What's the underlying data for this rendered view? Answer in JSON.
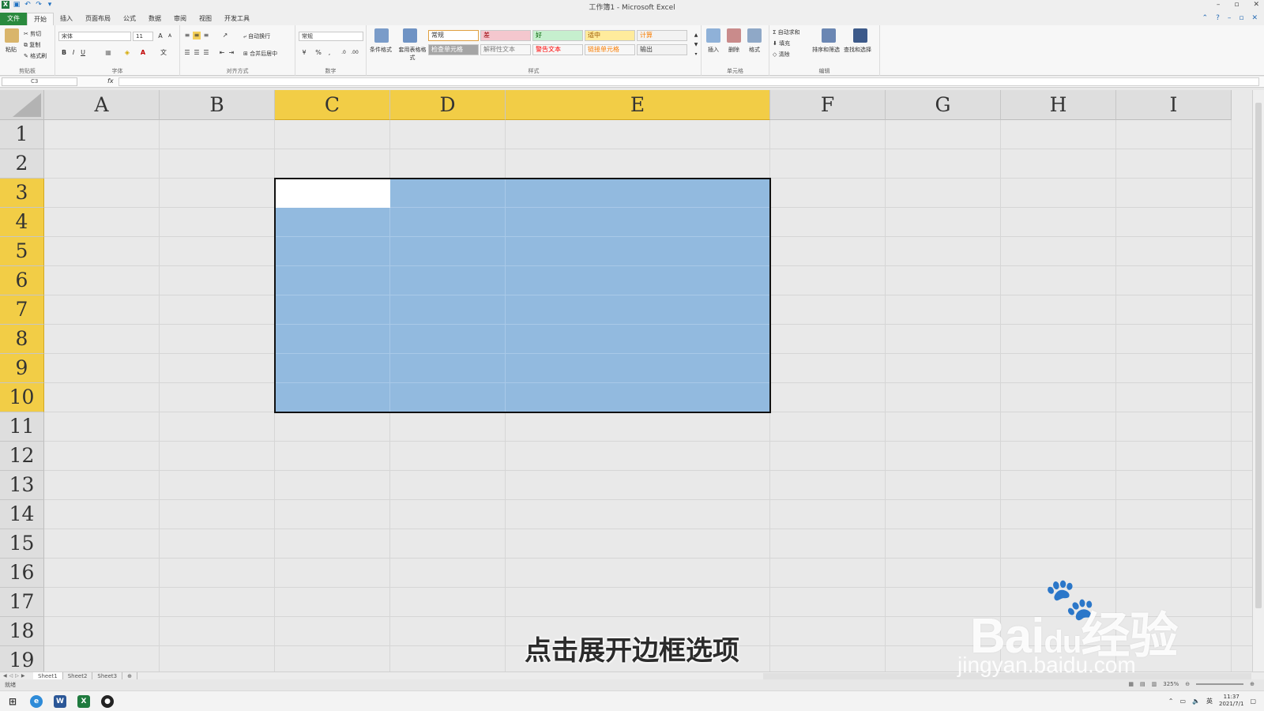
{
  "window": {
    "title": "工作簿1 - Microsoft Excel",
    "controls": [
      "–",
      "▫",
      "✕"
    ]
  },
  "tabs": [
    "文件",
    "开始",
    "插入",
    "页面布局",
    "公式",
    "数据",
    "审阅",
    "视图",
    "开发工具"
  ],
  "ribbon": {
    "clipboard": {
      "label": "剪贴板",
      "paste": "粘贴",
      "cut": "剪切",
      "copy": "复制",
      "format_painter": "格式刷"
    },
    "font": {
      "label": "字体",
      "font_name": "宋体",
      "font_size": "11",
      "bold": "B",
      "italic": "I",
      "underline": "U"
    },
    "alignment": {
      "label": "对齐方式",
      "wrap": "自动换行",
      "merge": "合并后居中"
    },
    "number": {
      "label": "数字",
      "format": "常规",
      "percent": "%"
    },
    "styles": {
      "label": "样式",
      "conditional": "条件格式",
      "table": "套用表格格式",
      "cells": [
        {
          "text": "常规",
          "bg": "#ffffff",
          "fg": "#333333"
        },
        {
          "text": "差",
          "bg": "#f4c7ce",
          "fg": "#9c0006"
        },
        {
          "text": "好",
          "bg": "#c6efce",
          "fg": "#006100"
        },
        {
          "text": "适中",
          "bg": "#ffeb9c",
          "fg": "#9c5700"
        },
        {
          "text": "计算",
          "bg": "#f2f2f2",
          "fg": "#fa7d00"
        },
        {
          "text": "检查单元格",
          "bg": "#a5a5a5",
          "fg": "#ffffff"
        },
        {
          "text": "解释性文本",
          "bg": "#f7f7f7",
          "fg": "#7f7f7f"
        },
        {
          "text": "警告文本",
          "bg": "#f7f7f7",
          "fg": "#ff0000"
        },
        {
          "text": "链接单元格",
          "bg": "#f7f7f7",
          "fg": "#fa7d00"
        },
        {
          "text": "输出",
          "bg": "#f2f2f2",
          "fg": "#3f3f3f"
        }
      ]
    },
    "cells_group": {
      "label": "单元格",
      "insert": "插入",
      "delete": "删除",
      "format": "格式"
    },
    "editing": {
      "label": "编辑",
      "autosum": "自动求和",
      "fill": "填充",
      "clear": "清除",
      "sort": "排序和筛选",
      "find": "查找和选择"
    }
  },
  "formula_bar": {
    "name_box": "C3",
    "fx": "fx",
    "value": ""
  },
  "grid": {
    "columns": [
      "A",
      "B",
      "C",
      "D",
      "E",
      "F",
      "G",
      "H",
      "I"
    ],
    "selected_columns": [
      "C",
      "D",
      "E"
    ],
    "rows": [
      "1",
      "2",
      "3",
      "4",
      "5",
      "6",
      "7",
      "8",
      "9",
      "10",
      "11",
      "12",
      "13",
      "14",
      "15",
      "16",
      "17",
      "18",
      "19"
    ],
    "selected_rows": [
      "3",
      "4",
      "5",
      "6",
      "7",
      "8",
      "9",
      "10"
    ],
    "active_cell": "C3",
    "selection_color": "#92badf",
    "header_highlight": "#f2cd46"
  },
  "sheets": [
    "Sheet1",
    "Sheet2",
    "Sheet3"
  ],
  "status": {
    "ready": "就绪",
    "zoom": "325%"
  },
  "taskbar": {
    "time": "11:37",
    "date": "2021/7/1",
    "ime": "英"
  },
  "subtitle": "点击展开边框选项",
  "watermark": {
    "brand": "Bai",
    "brand2": "经验",
    "url": "jingyan.baidu.com"
  }
}
